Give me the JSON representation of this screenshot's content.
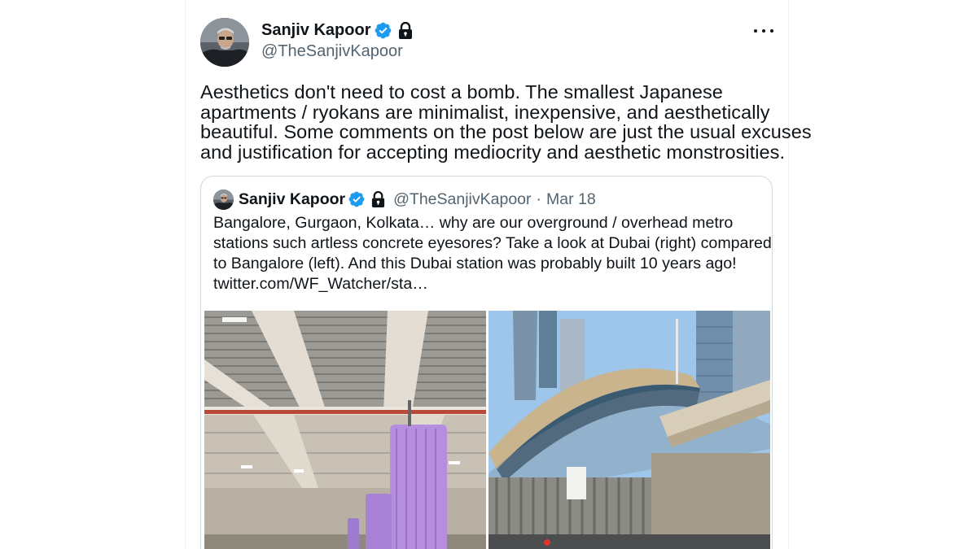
{
  "post": {
    "author": {
      "name": "Sanjiv Kapoor",
      "handle": "@TheSanjivKapoor",
      "verified": true,
      "protected": true
    },
    "text_lines": [
      "Aesthetics don't need to cost a bomb. The smallest Japanese",
      "apartments / ryokans are minimalist, inexpensive, and aesthetically",
      "beautiful. Some comments on the post below are just the usual excuses",
      "and justification for accepting mediocrity and aesthetic monstrosities."
    ],
    "more_icon": "more-horizontal-icon"
  },
  "quote": {
    "author": {
      "name": "Sanjiv Kapoor",
      "handle": "@TheSanjivKapoor",
      "separator": "·",
      "date": "Mar 18"
    },
    "text_lines": [
      "Bangalore, Gurgaon, Kolkata… why are our overground  / overhead metro",
      "stations such artless concrete eyesores? Take a look at Dubai (right) compared",
      "to Bangalore (left). And this Dubai station was probably built 10 years ago!",
      "twitter.com/WF_Watcher/sta…"
    ],
    "media": [
      {
        "subject": "concrete metro station interior with purple pillars"
      },
      {
        "subject": "curved metro station with skyscrapers"
      }
    ]
  },
  "colors": {
    "text": "#0f1419",
    "secondary": "#536471",
    "verified_blue": "#1d9bf0",
    "border": "#cfd9de"
  }
}
